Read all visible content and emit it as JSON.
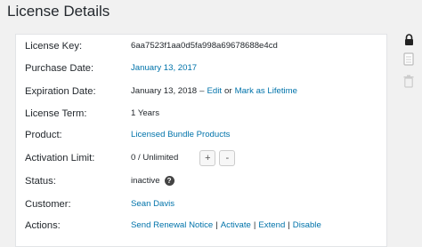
{
  "page": {
    "title": "License Details"
  },
  "details": {
    "license_key": {
      "label": "License Key:",
      "value": "6aa7523f1aa0d5fa998a69678688e4cd"
    },
    "purchase_date": {
      "label": "Purchase Date:",
      "value": "January 13, 2017"
    },
    "expiration_date": {
      "label": "Expiration Date:",
      "value": "January 13, 2018",
      "edit": "Edit",
      "or": "or",
      "mark_lifetime": "Mark as Lifetime",
      "separator": "–"
    },
    "license_term": {
      "label": "License Term:",
      "value": "1 Years"
    },
    "product": {
      "label": "Product:",
      "value": "Licensed Bundle Products"
    },
    "activation_limit": {
      "label": "Activation Limit:",
      "value": "0 / Unlimited",
      "plus": "+",
      "minus": "-"
    },
    "status": {
      "label": "Status:",
      "value": "inactive",
      "help": "?"
    },
    "customer": {
      "label": "Customer:",
      "value": "Sean Davis"
    },
    "actions": {
      "label": "Actions:",
      "items": [
        "Send Renewal Notice",
        "Activate",
        "Extend",
        "Disable"
      ],
      "separator": "|"
    }
  },
  "side_icons": [
    "lock-icon",
    "document-icon",
    "trash-icon"
  ]
}
